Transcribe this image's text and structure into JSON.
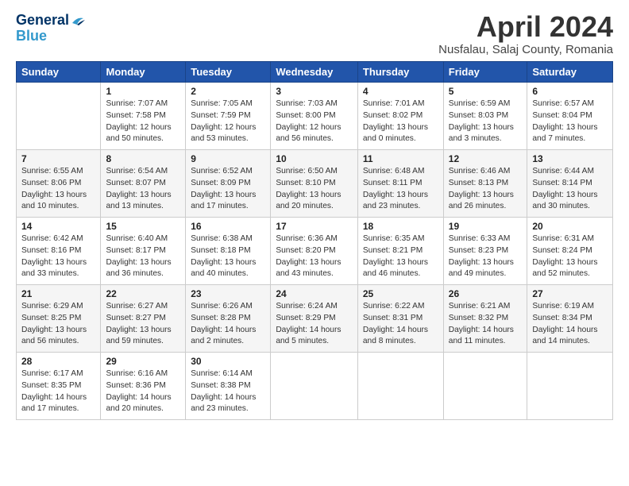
{
  "header": {
    "logo_line1": "General",
    "logo_line2": "Blue",
    "month_title": "April 2024",
    "location": "Nusfalau, Salaj County, Romania"
  },
  "weekdays": [
    "Sunday",
    "Monday",
    "Tuesday",
    "Wednesday",
    "Thursday",
    "Friday",
    "Saturday"
  ],
  "weeks": [
    [
      {
        "day": "",
        "info": ""
      },
      {
        "day": "1",
        "info": "Sunrise: 7:07 AM\nSunset: 7:58 PM\nDaylight: 12 hours\nand 50 minutes."
      },
      {
        "day": "2",
        "info": "Sunrise: 7:05 AM\nSunset: 7:59 PM\nDaylight: 12 hours\nand 53 minutes."
      },
      {
        "day": "3",
        "info": "Sunrise: 7:03 AM\nSunset: 8:00 PM\nDaylight: 12 hours\nand 56 minutes."
      },
      {
        "day": "4",
        "info": "Sunrise: 7:01 AM\nSunset: 8:02 PM\nDaylight: 13 hours\nand 0 minutes."
      },
      {
        "day": "5",
        "info": "Sunrise: 6:59 AM\nSunset: 8:03 PM\nDaylight: 13 hours\nand 3 minutes."
      },
      {
        "day": "6",
        "info": "Sunrise: 6:57 AM\nSunset: 8:04 PM\nDaylight: 13 hours\nand 7 minutes."
      }
    ],
    [
      {
        "day": "7",
        "info": "Sunrise: 6:55 AM\nSunset: 8:06 PM\nDaylight: 13 hours\nand 10 minutes."
      },
      {
        "day": "8",
        "info": "Sunrise: 6:54 AM\nSunset: 8:07 PM\nDaylight: 13 hours\nand 13 minutes."
      },
      {
        "day": "9",
        "info": "Sunrise: 6:52 AM\nSunset: 8:09 PM\nDaylight: 13 hours\nand 17 minutes."
      },
      {
        "day": "10",
        "info": "Sunrise: 6:50 AM\nSunset: 8:10 PM\nDaylight: 13 hours\nand 20 minutes."
      },
      {
        "day": "11",
        "info": "Sunrise: 6:48 AM\nSunset: 8:11 PM\nDaylight: 13 hours\nand 23 minutes."
      },
      {
        "day": "12",
        "info": "Sunrise: 6:46 AM\nSunset: 8:13 PM\nDaylight: 13 hours\nand 26 minutes."
      },
      {
        "day": "13",
        "info": "Sunrise: 6:44 AM\nSunset: 8:14 PM\nDaylight: 13 hours\nand 30 minutes."
      }
    ],
    [
      {
        "day": "14",
        "info": "Sunrise: 6:42 AM\nSunset: 8:16 PM\nDaylight: 13 hours\nand 33 minutes."
      },
      {
        "day": "15",
        "info": "Sunrise: 6:40 AM\nSunset: 8:17 PM\nDaylight: 13 hours\nand 36 minutes."
      },
      {
        "day": "16",
        "info": "Sunrise: 6:38 AM\nSunset: 8:18 PM\nDaylight: 13 hours\nand 40 minutes."
      },
      {
        "day": "17",
        "info": "Sunrise: 6:36 AM\nSunset: 8:20 PM\nDaylight: 13 hours\nand 43 minutes."
      },
      {
        "day": "18",
        "info": "Sunrise: 6:35 AM\nSunset: 8:21 PM\nDaylight: 13 hours\nand 46 minutes."
      },
      {
        "day": "19",
        "info": "Sunrise: 6:33 AM\nSunset: 8:23 PM\nDaylight: 13 hours\nand 49 minutes."
      },
      {
        "day": "20",
        "info": "Sunrise: 6:31 AM\nSunset: 8:24 PM\nDaylight: 13 hours\nand 52 minutes."
      }
    ],
    [
      {
        "day": "21",
        "info": "Sunrise: 6:29 AM\nSunset: 8:25 PM\nDaylight: 13 hours\nand 56 minutes."
      },
      {
        "day": "22",
        "info": "Sunrise: 6:27 AM\nSunset: 8:27 PM\nDaylight: 13 hours\nand 59 minutes."
      },
      {
        "day": "23",
        "info": "Sunrise: 6:26 AM\nSunset: 8:28 PM\nDaylight: 14 hours\nand 2 minutes."
      },
      {
        "day": "24",
        "info": "Sunrise: 6:24 AM\nSunset: 8:29 PM\nDaylight: 14 hours\nand 5 minutes."
      },
      {
        "day": "25",
        "info": "Sunrise: 6:22 AM\nSunset: 8:31 PM\nDaylight: 14 hours\nand 8 minutes."
      },
      {
        "day": "26",
        "info": "Sunrise: 6:21 AM\nSunset: 8:32 PM\nDaylight: 14 hours\nand 11 minutes."
      },
      {
        "day": "27",
        "info": "Sunrise: 6:19 AM\nSunset: 8:34 PM\nDaylight: 14 hours\nand 14 minutes."
      }
    ],
    [
      {
        "day": "28",
        "info": "Sunrise: 6:17 AM\nSunset: 8:35 PM\nDaylight: 14 hours\nand 17 minutes."
      },
      {
        "day": "29",
        "info": "Sunrise: 6:16 AM\nSunset: 8:36 PM\nDaylight: 14 hours\nand 20 minutes."
      },
      {
        "day": "30",
        "info": "Sunrise: 6:14 AM\nSunset: 8:38 PM\nDaylight: 14 hours\nand 23 minutes."
      },
      {
        "day": "",
        "info": ""
      },
      {
        "day": "",
        "info": ""
      },
      {
        "day": "",
        "info": ""
      },
      {
        "day": "",
        "info": ""
      }
    ]
  ]
}
